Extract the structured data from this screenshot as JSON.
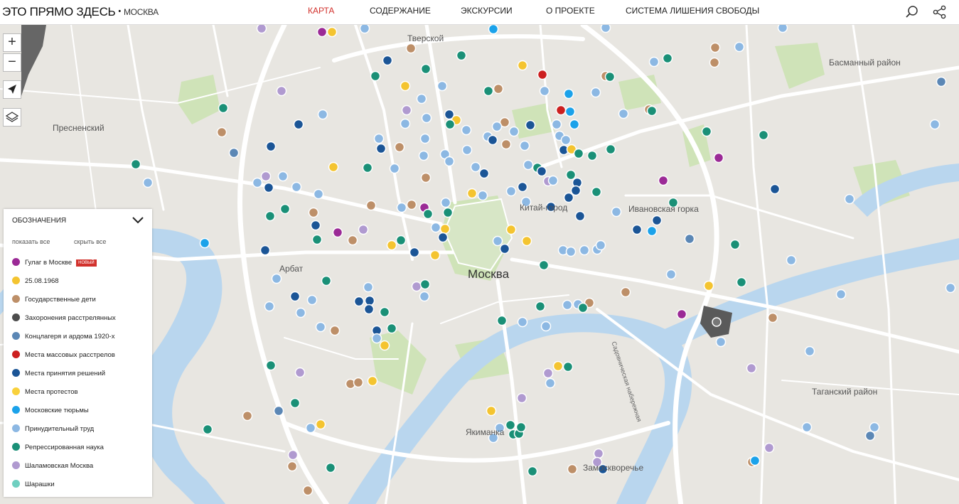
{
  "header": {
    "site_title": "ЭТО ПРЯМО ЗДЕСЬ",
    "separator": "•",
    "city": "МОСКВА",
    "nav": [
      {
        "label": "КАРТА",
        "active": true
      },
      {
        "label": "СОДЕРЖАНИЕ",
        "active": false
      },
      {
        "label": "ЭКСКУРСИИ",
        "active": false
      },
      {
        "label": "О ПРОЕКТЕ",
        "active": false
      },
      {
        "label": "СИСТЕМА ЛИШЕНИЯ СВОБОДЫ",
        "active": false
      }
    ],
    "icons": [
      "search-icon",
      "share-icon"
    ]
  },
  "map_controls": {
    "zoom_in": "+",
    "zoom_out": "−",
    "icons": [
      "locate-arrow-icon",
      "layers-icon"
    ]
  },
  "map_labels": {
    "moscow": "Москва",
    "tverskoy": "Тверской",
    "basmanny": "Басманный район",
    "presnensky": "Пресненский",
    "kitay_gorod": "Китай-город",
    "ivanovskaya": "Ивановская горка",
    "arbat": "Арбат",
    "tagansky": "Таганский район",
    "yakimanka": "Якиманка",
    "zamoskvorechye": "Замоскворечье",
    "embankment": "Садовническая набережная"
  },
  "legend": {
    "title": "ОБОЗНАЧЕНИЯ",
    "show_all": "показать все",
    "hide_all": "скрыть все",
    "new_badge": "НОВЫЙ",
    "items": [
      {
        "label": "Гулаг в Москве",
        "color": "#9b2a96",
        "new": true
      },
      {
        "label": "25.08.1968",
        "color": "#f4c430",
        "new": false
      },
      {
        "label": "Государственные дети",
        "color": "#bd8f68",
        "new": false
      },
      {
        "label": "Захоронения расстрелянных",
        "color": "#4d4d4d",
        "new": false
      },
      {
        "label": "Концлагеря и ардома 1920-х",
        "color": "#5b87b5",
        "new": false
      },
      {
        "label": "Места массовых расстрелов",
        "color": "#cc1f1f",
        "new": false
      },
      {
        "label": "Места принятия решений",
        "color": "#1b5596",
        "new": false
      },
      {
        "label": "Места протестов",
        "color": "#f9d13c",
        "new": false
      },
      {
        "label": "Московские тюрьмы",
        "color": "#1ba2ea",
        "new": false
      },
      {
        "label": "Принудительный труд",
        "color": "#8cb8e3",
        "new": false
      },
      {
        "label": "Репрессированная наука",
        "color": "#1a9077",
        "new": false
      },
      {
        "label": "Шаламовская Москва",
        "color": "#b09ad0",
        "new": false
      },
      {
        "label": "Шарашки",
        "color": "#6fcfc0",
        "new": false
      }
    ]
  }
}
